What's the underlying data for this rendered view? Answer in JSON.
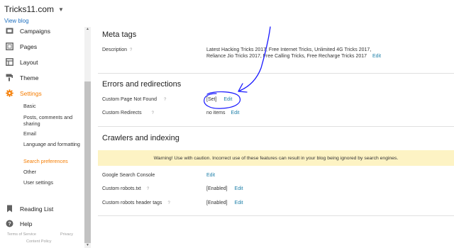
{
  "header": {
    "blog_name": "Tricks11.com",
    "view_blog": "View blog"
  },
  "sidebar": {
    "items": [
      {
        "label": "Campaigns",
        "icon": "campaigns-icon"
      },
      {
        "label": "Pages",
        "icon": "pages-icon"
      },
      {
        "label": "Layout",
        "icon": "layout-icon"
      },
      {
        "label": "Theme",
        "icon": "theme-icon"
      },
      {
        "label": "Settings",
        "icon": "gear-icon",
        "active": true
      }
    ],
    "settings_sub": [
      {
        "label": "Basic"
      },
      {
        "label": "Posts, comments and sharing"
      },
      {
        "label": "Email"
      },
      {
        "label": "Language and formatting"
      },
      {
        "label": "Search preferences",
        "active": true
      },
      {
        "label": "Other"
      },
      {
        "label": "User settings"
      }
    ],
    "bottom_items": [
      {
        "label": "Reading List",
        "icon": "bookmark-icon"
      },
      {
        "label": "Help",
        "icon": "help-icon"
      }
    ],
    "footer": {
      "terms": "Terms of Service",
      "privacy": "Privacy",
      "content_policy": "Content Policy"
    }
  },
  "main": {
    "meta_tags": {
      "title": "Meta tags",
      "description_label": "Description",
      "description_value": "Latest Hacking Tricks 2017, Free Internet Tricks, Unlimited 4G Tricks 2017, Reliance Jio Tricks 2017, Free Calling Tricks, Free Recharge Tricks 2017",
      "edit": "Edit"
    },
    "errors": {
      "title": "Errors and redirections",
      "not_found_label": "Custom Page Not Found",
      "not_found_value": "[Set]",
      "redirects_label": "Custom Redirects",
      "redirects_value": "no items",
      "edit": "Edit"
    },
    "crawlers": {
      "title": "Crawlers and indexing",
      "warning": "Warning! Use with caution. Incorrect use of these features can result in your blog being ignored by search engines.",
      "gsc_label": "Google Search Console",
      "robots_label": "Custom robots.txt",
      "robots_value": "[Enabled]",
      "header_tags_label": "Custom robots header tags",
      "header_tags_value": "[Enabled]",
      "edit": "Edit"
    },
    "help_icon": "?"
  },
  "colors": {
    "accent": "#f57c00",
    "link": "#1e7fa8",
    "warning_bg": "#fdf3c4",
    "annotation": "#1a1aff"
  }
}
